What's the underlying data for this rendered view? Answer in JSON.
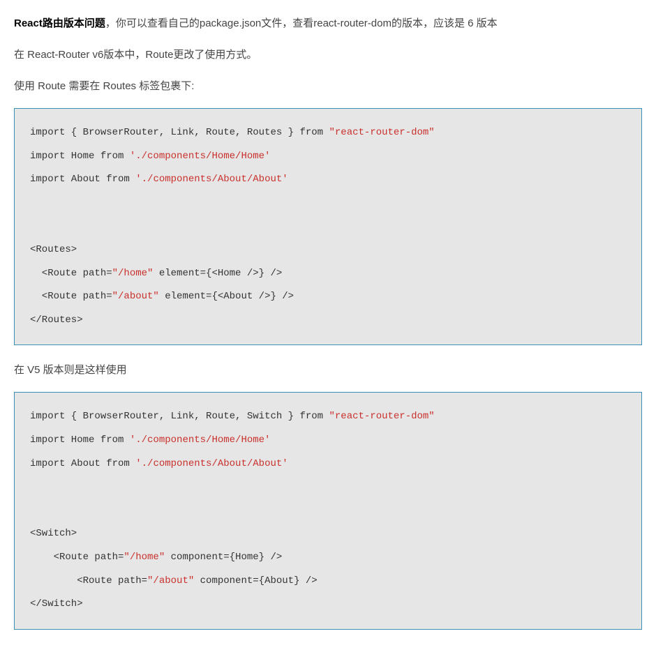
{
  "p1": {
    "bold": "React路由版本问题",
    "rest": "，你可以查看自己的package.json文件，查看react-router-dom的版本，应该是 6 版本"
  },
  "p2": "在 React-Router v6版本中，Route更改了使用方式。",
  "p3": "使用 Route 需要在 Routes 标签包裹下:",
  "code1": {
    "l1a": "import { BrowserRouter, Link, Route, Routes } from ",
    "l1b": "\"react-router-dom\"",
    "l2a": "import Home from ",
    "l2b": "'./components/Home/Home'",
    "l3a": "import About from ",
    "l3b": "'./components/About/About'",
    "l4": "<Routes>",
    "l5a": "  <Route path=",
    "l5b": "\"/home\"",
    "l5c": " element={<Home />} />",
    "l6a": "  <Route path=",
    "l6b": "\"/about\"",
    "l6c": " element={<About />} />",
    "l7": "</Routes>"
  },
  "p4": "在 V5 版本则是这样使用",
  "code2": {
    "l1a": "import { BrowserRouter, Link, Route, Switch } from ",
    "l1b": "\"react-router-dom\"",
    "l2a": "import Home from ",
    "l2b": "'./components/Home/Home'",
    "l3a": "import About from ",
    "l3b": "'./components/About/About'",
    "l4": "<Switch>",
    "l5a": "    <Route path=",
    "l5b": "\"/home\"",
    "l5c": " component={Home} />",
    "l6a": "        <Route path=",
    "l6b": "\"/about\"",
    "l6c": " component={About} />",
    "l7": "</Switch>"
  }
}
